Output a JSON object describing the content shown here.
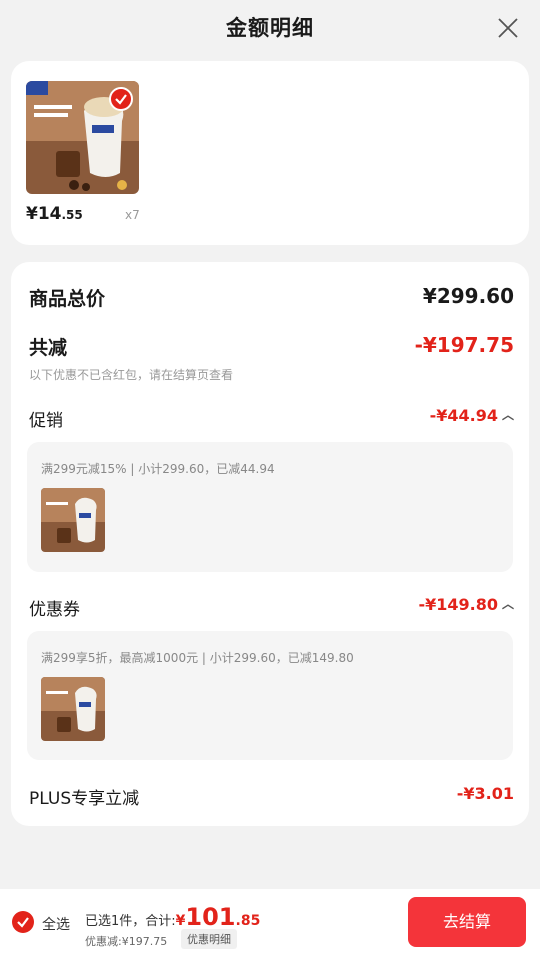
{
  "header": {
    "title": "金额明细"
  },
  "product": {
    "price_int": "¥14",
    "price_dec": ".55",
    "qty": "x7"
  },
  "summary": {
    "total_label": "商品总价",
    "total_value": "¥299.60",
    "discount_label": "共减",
    "discount_value": "-¥197.75",
    "note": "以下优惠不已含红包，请在结算页查看"
  },
  "promo": {
    "label": "促销",
    "value": "-¥44.94",
    "detail": "满299元减15% | 小计299.60，已减44.94"
  },
  "coupon": {
    "label": "优惠券",
    "value": "-¥149.80",
    "detail": "满299享5折，最高减1000元 | 小计299.60，已减149.80"
  },
  "plus": {
    "label": "PLUS专享立减",
    "value": "-¥3.01"
  },
  "bottom": {
    "select_all": "全选",
    "selected_text": "已选1件，合计:",
    "total_cur": "¥",
    "total_int": "101",
    "total_dec": ".85",
    "saved_text": "优惠减:¥197.75",
    "detail_tag": "优惠明细",
    "checkout": "去结算"
  },
  "colors": {
    "accent": "#e2231a",
    "checkout_bg": "#f4343a"
  },
  "icons": [
    "close-icon",
    "check-icon",
    "chevron-up-icon"
  ]
}
